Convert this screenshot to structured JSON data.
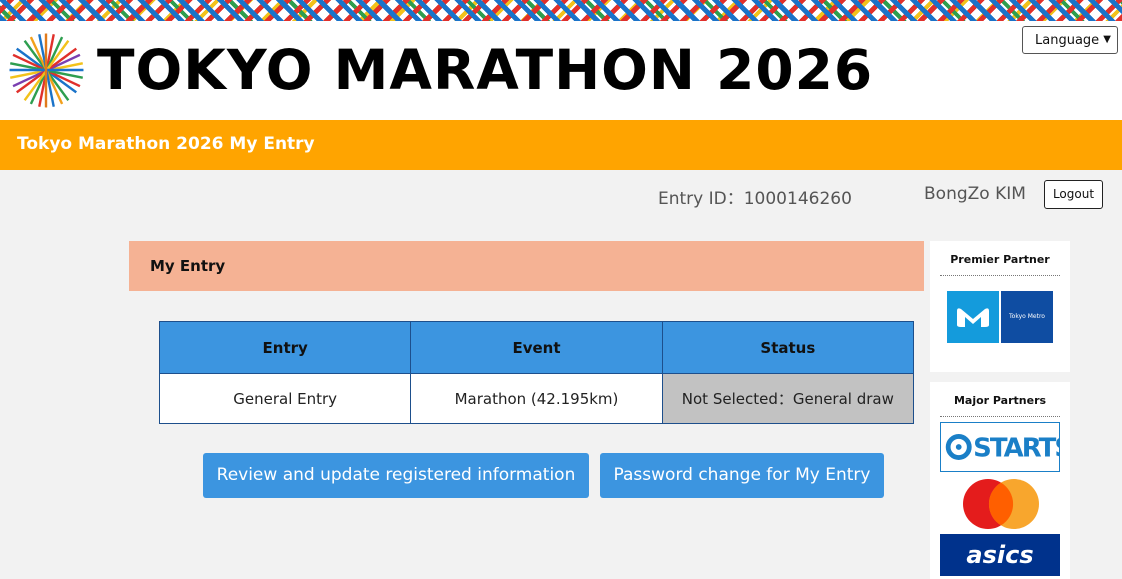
{
  "header": {
    "title": "TOKYO MARATHON 2026",
    "logo_icon": "tokyo-marathon-logo-icon",
    "language_select": {
      "label": "Language"
    }
  },
  "banner": {
    "text": "Tokyo Marathon 2026 My Entry"
  },
  "account": {
    "entry_id": "Entry ID：1000146260",
    "user_name": "BongZo KIM",
    "logout_label": "Logout"
  },
  "section": {
    "title": "My Entry"
  },
  "entry_table": {
    "headers": [
      "Entry",
      "Event",
      "Status"
    ],
    "rows": [
      [
        "General Entry",
        "Marathon (42.195km)",
        "Not Selected：General draw"
      ]
    ]
  },
  "actions": {
    "review_label": "Review and update registered information",
    "password_label": "Password change for My Entry"
  },
  "partners": {
    "premier_title": "Premier Partner",
    "premier": [
      {
        "name": "Tokyo Metro"
      }
    ],
    "major_title": "Major Partners",
    "major": [
      {
        "name": "STARTS"
      },
      {
        "name": "Mastercard"
      },
      {
        "name": "asics"
      }
    ]
  },
  "colors": {
    "banner": "#ffa400",
    "section_head": "#f5b294",
    "primary_button": "#3c95e0",
    "status_cell": "#c2c2c2"
  }
}
